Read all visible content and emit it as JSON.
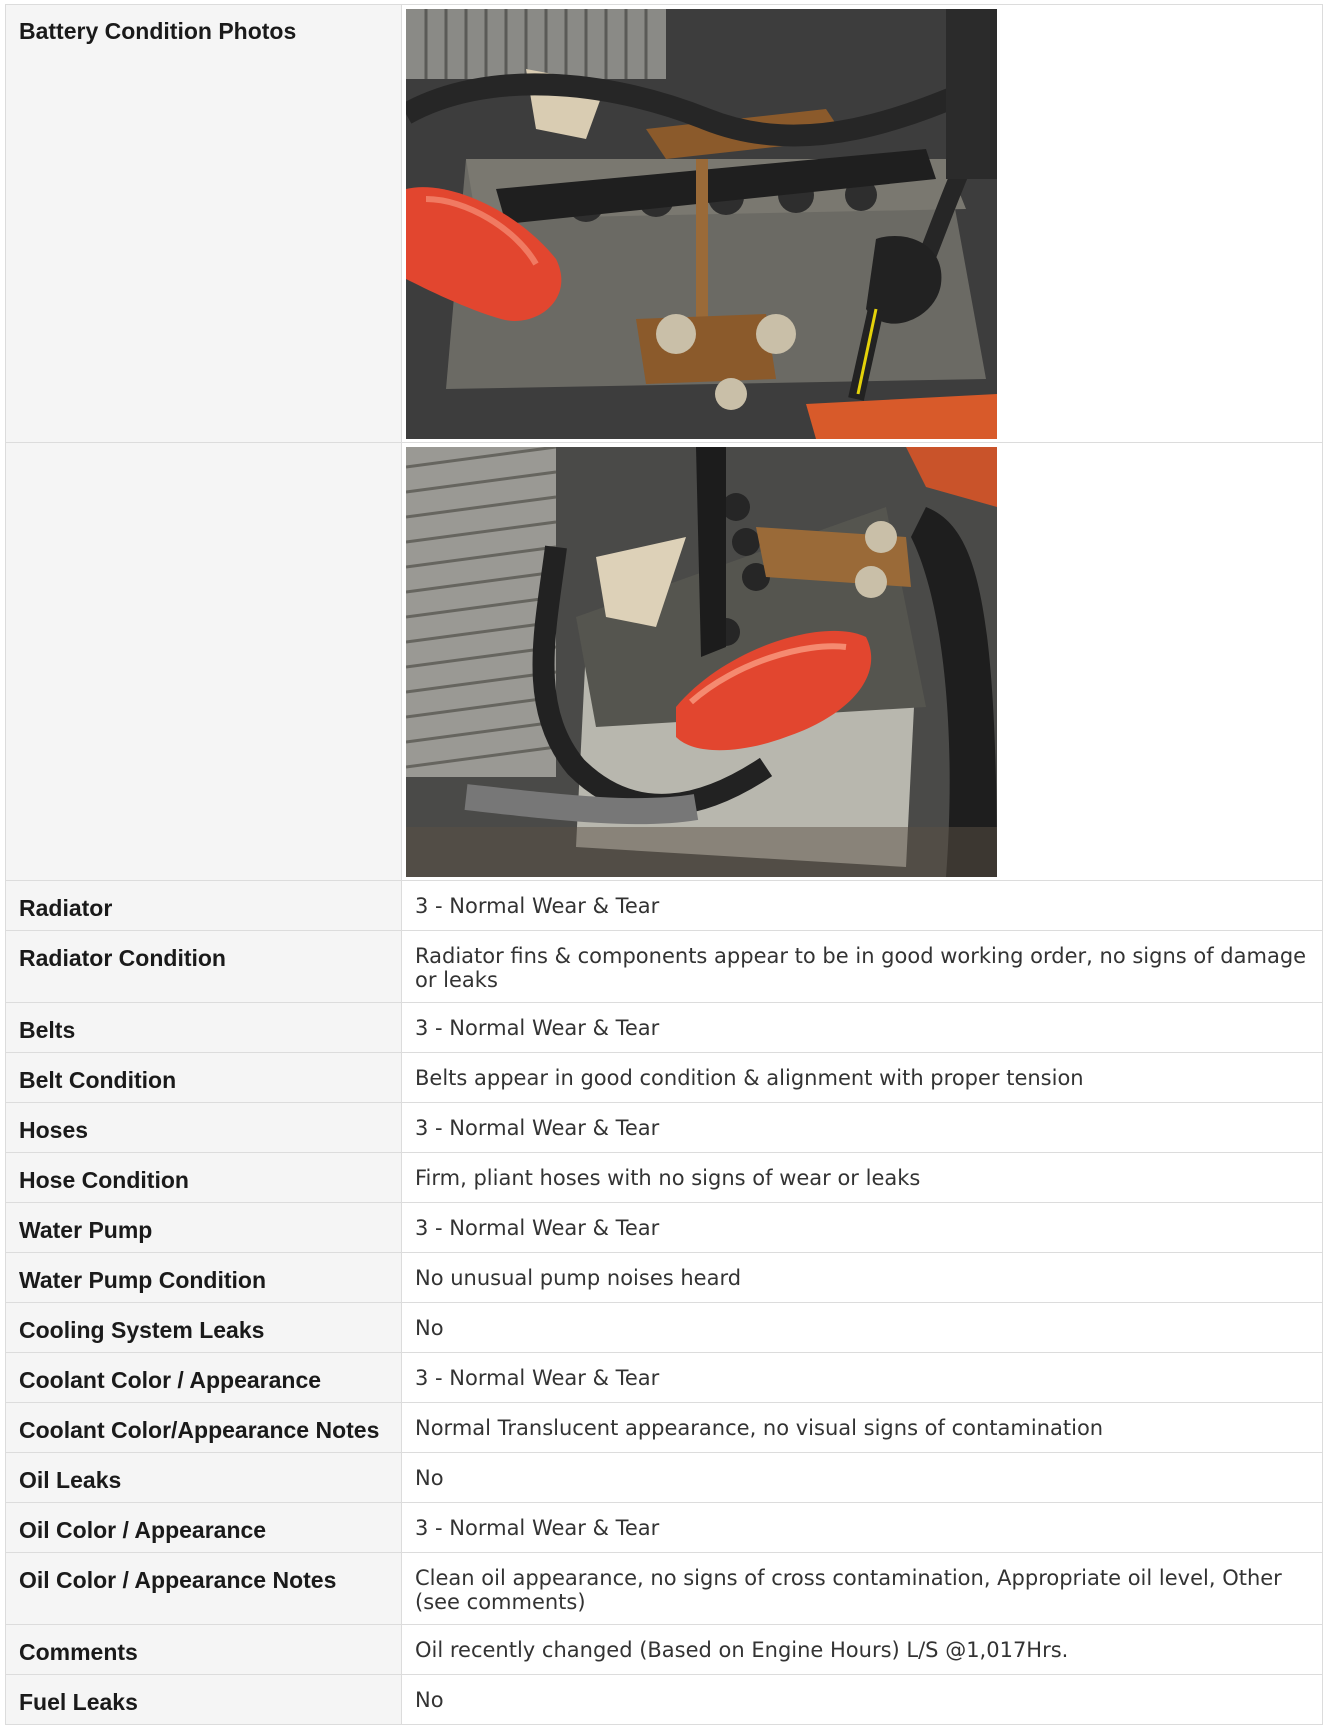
{
  "rows": [
    {
      "label": "Battery Condition Photos",
      "value": ""
    },
    {
      "label": "",
      "value": ""
    },
    {
      "label": "Radiator",
      "value": "3 - Normal Wear & Tear"
    },
    {
      "label": "Radiator Condition",
      "value": "Radiator fins & components appear to be in good working order, no signs of damage or leaks"
    },
    {
      "label": "Belts",
      "value": "3 - Normal Wear & Tear"
    },
    {
      "label": "Belt Condition",
      "value": "Belts appear in good condition & alignment with proper tension"
    },
    {
      "label": "Hoses",
      "value": "3 - Normal Wear & Tear"
    },
    {
      "label": "Hose Condition",
      "value": "Firm, pliant hoses with no signs of wear or leaks"
    },
    {
      "label": "Water Pump",
      "value": "3 - Normal Wear & Tear"
    },
    {
      "label": "Water Pump Condition",
      "value": "No unusual pump noises heard"
    },
    {
      "label": "Cooling System Leaks",
      "value": "No"
    },
    {
      "label": "Coolant Color / Appearance",
      "value": "3 - Normal Wear & Tear"
    },
    {
      "label": "Coolant Color/Appearance Notes",
      "value": "Normal Translucent appearance, no visual signs of contamination"
    },
    {
      "label": "Oil Leaks",
      "value": "No"
    },
    {
      "label": "Oil Color / Appearance",
      "value": "3 - Normal Wear & Tear"
    },
    {
      "label": "Oil Color / Appearance Notes",
      "value": "Clean oil appearance, no signs of cross contamination, Appropriate oil level, Other (see comments)"
    },
    {
      "label": "Comments",
      "value": "Oil recently changed (Based on Engine Hours) L/S @1,017Hrs."
    },
    {
      "label": "Fuel Leaks",
      "value": "No"
    }
  ],
  "colors": {
    "label_bg": "#f5f5f5",
    "border": "#dcdcdc",
    "terminal_cover_red": "#e2462f"
  }
}
